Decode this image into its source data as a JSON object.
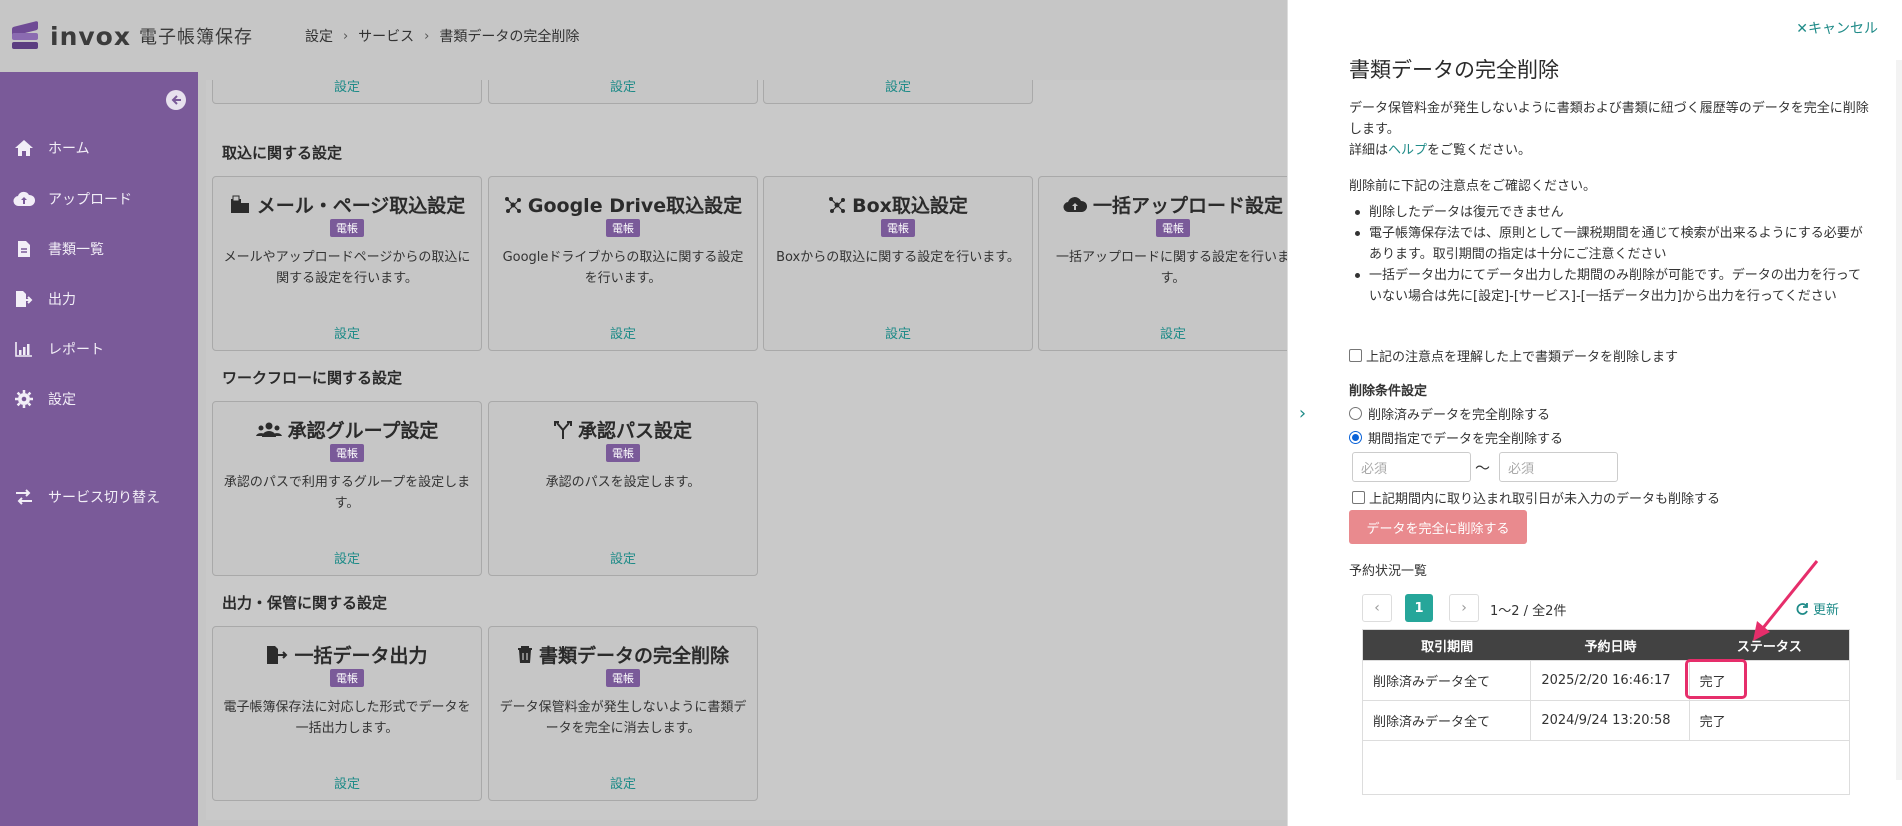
{
  "header": {
    "logo_text": "invox",
    "logo_sub": "電子帳簿保存",
    "breadcrumb": [
      "設定",
      "サービス",
      "書類データの完全削除"
    ]
  },
  "sidebar": {
    "items": [
      {
        "label": "ホーム",
        "icon": "home-icon"
      },
      {
        "label": "アップロード",
        "icon": "cloud-upload-icon"
      },
      {
        "label": "書類一覧",
        "icon": "document-icon"
      },
      {
        "label": "出力",
        "icon": "file-export-icon"
      },
      {
        "label": "レポート",
        "icon": "chart-icon"
      },
      {
        "label": "設定",
        "icon": "gear-icon"
      },
      {
        "label": "サービス切り替え",
        "icon": "switch-icon"
      }
    ]
  },
  "main": {
    "top_links": [
      "設定",
      "設定",
      "設定"
    ],
    "sections": [
      {
        "title": "取込に関する設定",
        "cards": [
          {
            "title": "メール・ページ取込設定",
            "badge": "電帳",
            "desc": "メールやアップロードページからの取込に関する設定を行います。",
            "link": "設定"
          },
          {
            "title": "Google Drive取込設定",
            "badge": "電帳",
            "desc": "Googleドライブからの取込に関する設定を行います。",
            "link": "設定"
          },
          {
            "title": "Box取込設定",
            "badge": "電帳",
            "desc": "Boxからの取込に関する設定を行います。",
            "link": "設定"
          },
          {
            "title": "一括アップロード設定",
            "badge": "電帳",
            "desc": "一括アップロードに関する設定を行います。",
            "link": "設定"
          }
        ]
      },
      {
        "title": "ワークフローに関する設定",
        "cards": [
          {
            "title": "承認グループ設定",
            "badge": "電帳",
            "desc": "承認のパスで利用するグループを設定します。",
            "link": "設定"
          },
          {
            "title": "承認パス設定",
            "badge": "電帳",
            "desc": "承認のパスを設定します。",
            "link": "設定"
          }
        ]
      },
      {
        "title": "出力・保管に関する設定",
        "cards": [
          {
            "title": "一括データ出力",
            "badge": "電帳",
            "desc": "電子帳簿保存法に対応した形式でデータを一括出力します。",
            "link": "設定"
          },
          {
            "title": "書類データの完全削除",
            "badge": "電帳",
            "desc": "データ保管料金が発生しないように書類データを完全に消去します。",
            "link": "設定"
          }
        ]
      }
    ]
  },
  "panel": {
    "cancel_label": "キャンセル",
    "title": "書類データの完全削除",
    "intro": "データ保管料金が発生しないように書類および書類に紐づく履歴等のデータを完全に削除します。",
    "help_prefix": "詳細は",
    "help_link": "ヘルプ",
    "help_suffix": "をご覧ください。",
    "notice_heading": "削除前に下記の注意点をご確認ください。",
    "notices": [
      "削除したデータは復元できません",
      "電子帳簿保存法では、原則として一課税期間を通じて検索が出来るようにする必要があります。取引期間の指定は十分にご注意ください",
      "一括データ出力にてデータ出力した期間のみ削除が可能です。データの出力を行っていない場合は先に[設定]-[サービス]-[一括データ出力]から出力を行ってください"
    ],
    "confirm_label": "上記の注意点を理解した上で書類データを削除します",
    "conditions_heading": "削除条件設定",
    "radio_options": [
      "削除済みデータを完全削除する",
      "期間指定でデータを完全削除する"
    ],
    "radio_selected": 1,
    "date_from_placeholder": "必須",
    "date_to_placeholder": "必須",
    "tilde": "〜",
    "include_label": "上記期間内に取り込まれ取引日が未入力のデータも削除する",
    "delete_button": "データを完全に削除する",
    "list_title": "予約状況一覧",
    "pager": {
      "current": "1",
      "info": "1〜2 / 全2件",
      "refresh": "更新"
    },
    "table": {
      "headers": [
        "取引期間",
        "予約日時",
        "ステータス"
      ],
      "rows": [
        [
          "削除済みデータ全て",
          "2025/2/20 16:46:17",
          "完了"
        ],
        [
          "削除済みデータ全て",
          "2024/9/24 13:20:58",
          "完了"
        ]
      ]
    }
  },
  "colors": {
    "sidebar": "#7a5a99",
    "accent": "#1f8b88",
    "badge": "#7a5a99",
    "delete_button": "#e98a8e",
    "highlight": "#e62e6b"
  }
}
